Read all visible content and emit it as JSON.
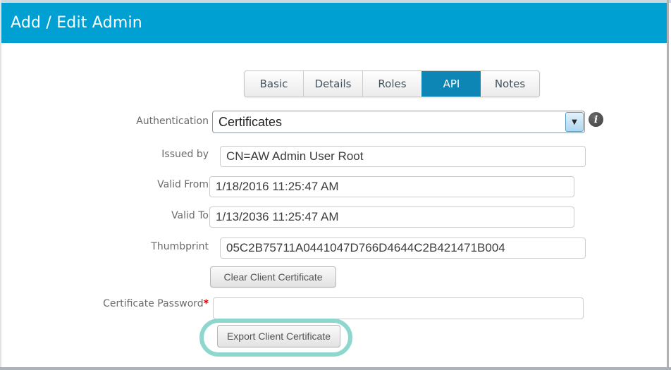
{
  "header": {
    "title": "Add / Edit Admin"
  },
  "tabs": [
    {
      "label": "Basic",
      "active": false
    },
    {
      "label": "Details",
      "active": false
    },
    {
      "label": "Roles",
      "active": false
    },
    {
      "label": "API",
      "active": true
    },
    {
      "label": "Notes",
      "active": false
    }
  ],
  "form": {
    "authentication": {
      "label": "Authentication",
      "value": "Certificates"
    },
    "issued_by": {
      "label": "Issued by",
      "value": "CN=AW Admin User Root"
    },
    "valid_from": {
      "label": "Valid From",
      "value": "1/18/2016 11:25:47 AM"
    },
    "valid_to": {
      "label": "Valid To",
      "value": "1/13/2036 11:25:47 AM"
    },
    "thumbprint": {
      "label": "Thumbprint",
      "value": "05C2B75711A0441047D766D4644C2B421471B004"
    },
    "clear_button_label": "Clear Client Certificate",
    "certificate_password": {
      "label": "Certificate Password",
      "required_marker": "*",
      "value": "",
      "placeholder": ""
    },
    "export_button_label": "Export Client Certificate"
  },
  "icons": {
    "dropdown_arrow": "▼",
    "info_glyph": "i"
  },
  "colors": {
    "header_bg": "#00a0d2",
    "active_tab_bg": "#0d86b5",
    "highlight_ring": "#8ed7cf",
    "required_marker": "#d40000"
  }
}
